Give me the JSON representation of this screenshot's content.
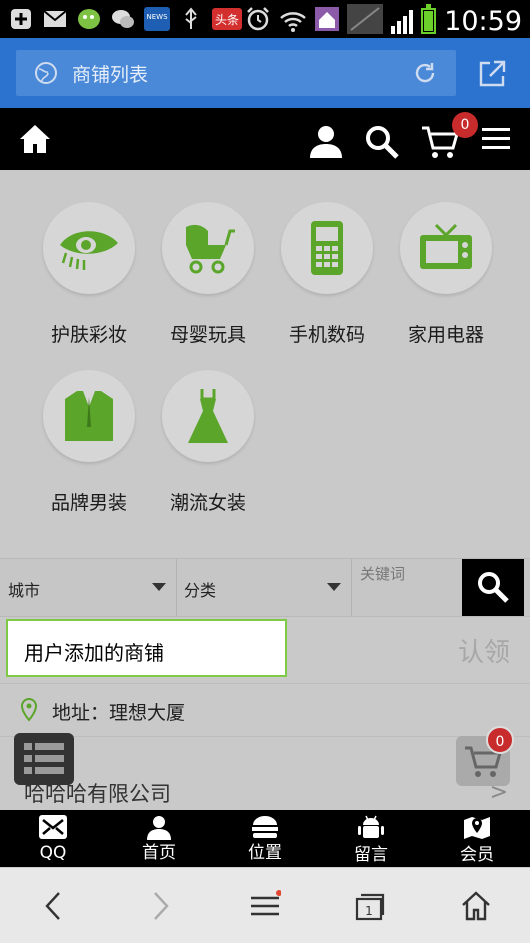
{
  "status_bar": {
    "time": "10:59",
    "badge_news": "NEWS",
    "badge_toutiao": "头条"
  },
  "browser": {
    "page_title": "商铺列表"
  },
  "header": {
    "cart_count": "0"
  },
  "categories": [
    {
      "label": "护肤彩妆",
      "icon": "eye-makeup-icon"
    },
    {
      "label": "母婴玩具",
      "icon": "stroller-icon"
    },
    {
      "label": "手机数码",
      "icon": "phone-icon"
    },
    {
      "label": "家用电器",
      "icon": "tv-icon"
    },
    {
      "label": "品牌男装",
      "icon": "suit-icon"
    },
    {
      "label": "潮流女装",
      "icon": "dress-icon"
    }
  ],
  "filters": {
    "city": "城市",
    "category": "分类",
    "keyword_placeholder": "关键词"
  },
  "shop": {
    "name": "用户添加的商铺",
    "claim": "认领",
    "address": "地址：理想大厦"
  },
  "next_shop": {
    "name": "哈哈哈有限公司",
    "arrow": ">"
  },
  "floating_cart_count": "0",
  "bottom_nav": [
    {
      "label": "QQ"
    },
    {
      "label": "首页"
    },
    {
      "label": "位置"
    },
    {
      "label": "留言"
    },
    {
      "label": "会员"
    }
  ],
  "colors": {
    "accent_green": "#5aa52a",
    "browser_blue": "#2b73cf",
    "badge_red": "#c82b2b"
  }
}
